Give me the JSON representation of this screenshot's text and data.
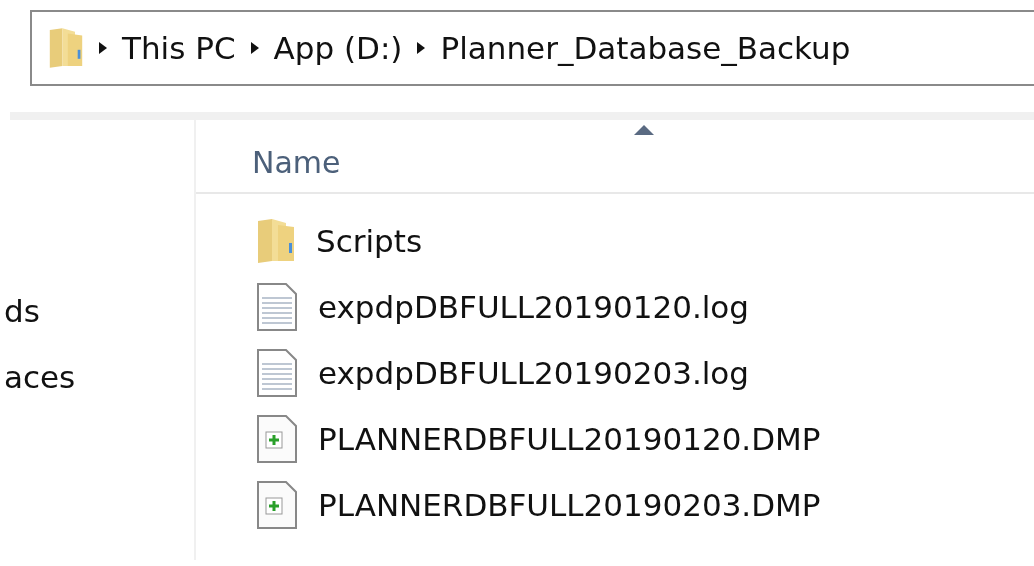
{
  "address_bar": {
    "crumbs": [
      "This PC",
      "App (D:)",
      "Planner_Database_Backup"
    ]
  },
  "nav_pane": {
    "items": [
      {
        "label": "ds"
      },
      {
        "label": "aces"
      }
    ]
  },
  "file_list": {
    "columns": [
      "Name"
    ],
    "rows": [
      {
        "name": "Scripts",
        "kind": "folder"
      },
      {
        "name": "expdpDBFULL20190120.log",
        "kind": "log"
      },
      {
        "name": "expdpDBFULL20190203.log",
        "kind": "log"
      },
      {
        "name": "PLANNERDBFULL20190120.DMP",
        "kind": "dmp"
      },
      {
        "name": "PLANNERDBFULL20190203.DMP",
        "kind": "dmp"
      }
    ]
  }
}
